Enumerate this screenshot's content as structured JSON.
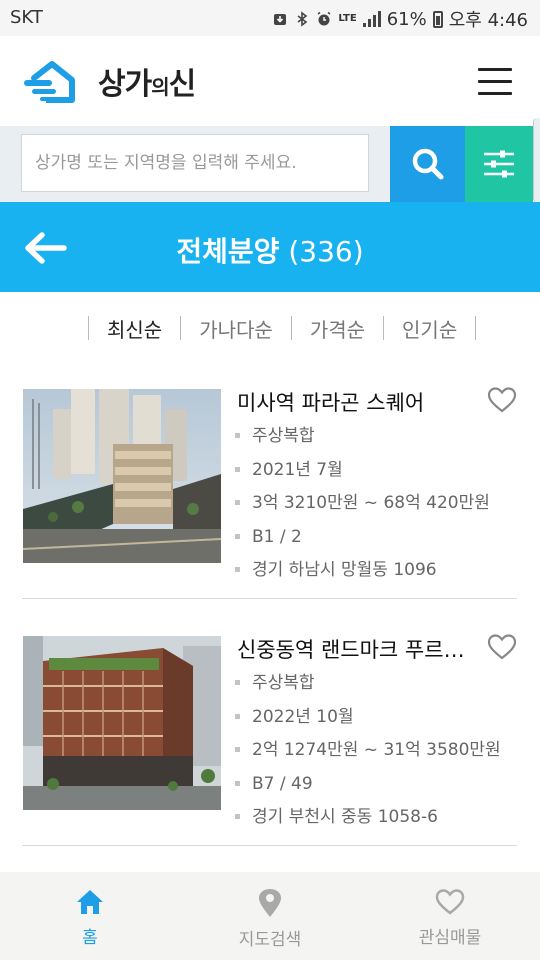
{
  "status_bar": {
    "carrier": "SKT",
    "network": "LTE",
    "battery": "61%",
    "time": "오후 4:46"
  },
  "header": {
    "logo_text_1": "상가",
    "logo_text_2": "의",
    "logo_text_3": "신",
    "menu_icon": "hamburger-icon"
  },
  "search": {
    "placeholder": "상가명 또는 지역명을 입력해 주세요.",
    "search_icon": "search-icon",
    "filter_icon": "sliders-icon"
  },
  "title_bar": {
    "title": "전체분양",
    "count": "(336)",
    "back_icon": "arrow-left-icon"
  },
  "sort_tabs": [
    {
      "label": "최신순",
      "active": true
    },
    {
      "label": "가나다순",
      "active": false
    },
    {
      "label": "가격순",
      "active": false
    },
    {
      "label": "인기순",
      "active": false
    }
  ],
  "listings": [
    {
      "name": "미사역 파라곤 스퀘어",
      "type": "주상복합",
      "date": "2021년 7월",
      "price": "3억 3210만원 ~ 68억 420만원",
      "floors": "B1 / 2",
      "address": "경기 하남시 망월동 1096"
    },
    {
      "name": "신중동역 랜드마크 푸르지오 시티",
      "type": "주상복합",
      "date": "2022년 10월",
      "price": "2억 1274만원 ~ 31억 3580만원",
      "floors": "B7 / 49",
      "address": "경기 부천시 중동 1058-6"
    }
  ],
  "bottom_nav": [
    {
      "label": "홈",
      "icon": "home-icon",
      "active": true
    },
    {
      "label": "지도검색",
      "icon": "map-pin-icon",
      "active": false
    },
    {
      "label": "관심매물",
      "icon": "heart-icon",
      "active": false
    }
  ],
  "colors": {
    "primary_blue": "#19b2f0",
    "search_blue": "#1e9ee6",
    "filter_green": "#20c5a4"
  }
}
